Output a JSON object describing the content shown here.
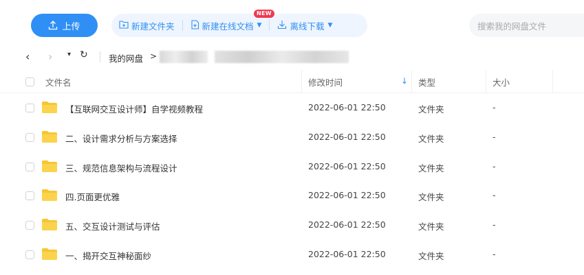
{
  "toolbar": {
    "upload_label": "上传",
    "new_folder_label": "新建文件夹",
    "new_online_doc_label": "新建在线文档",
    "new_badge": "NEW",
    "offline_download_label": "离线下载",
    "search_placeholder": "搜索我的网盘文件"
  },
  "nav": {
    "back_glyph": "‹",
    "forward_glyph": "›",
    "more_glyph": "▾",
    "refresh_glyph": "↻",
    "breadcrumb_root": "我的网盘",
    "breadcrumb_sep": ">"
  },
  "table": {
    "columns": {
      "name": "文件名",
      "modified": "修改时间",
      "type": "类型",
      "size": "大小"
    },
    "sort_glyph": "↓",
    "rows": [
      {
        "name": "【互联网交互设计师】自学视频教程",
        "modified": "2022-06-01 22:50",
        "type": "文件夹",
        "size": "-"
      },
      {
        "name": "二、设计需求分析与方案选择",
        "modified": "2022-06-01 22:50",
        "type": "文件夹",
        "size": "-"
      },
      {
        "name": "三、规范信息架构与流程设计",
        "modified": "2022-06-01 22:50",
        "type": "文件夹",
        "size": "-"
      },
      {
        "name": "四.页面更优雅",
        "modified": "2022-06-01 22:50",
        "type": "文件夹",
        "size": "-"
      },
      {
        "name": "五、交互设计测试与评估",
        "modified": "2022-06-01 22:50",
        "type": "文件夹",
        "size": "-"
      },
      {
        "name": "一、揭开交互神秘面纱",
        "modified": "2022-06-01 22:50",
        "type": "文件夹",
        "size": "-"
      }
    ]
  },
  "colors": {
    "accent": "#2f8ff5",
    "folder": "#f8c532",
    "badge": "#f0394f"
  },
  "icons": {
    "upload": "upload-icon",
    "folder": "folder-icon",
    "sort": "sort-desc-icon"
  }
}
